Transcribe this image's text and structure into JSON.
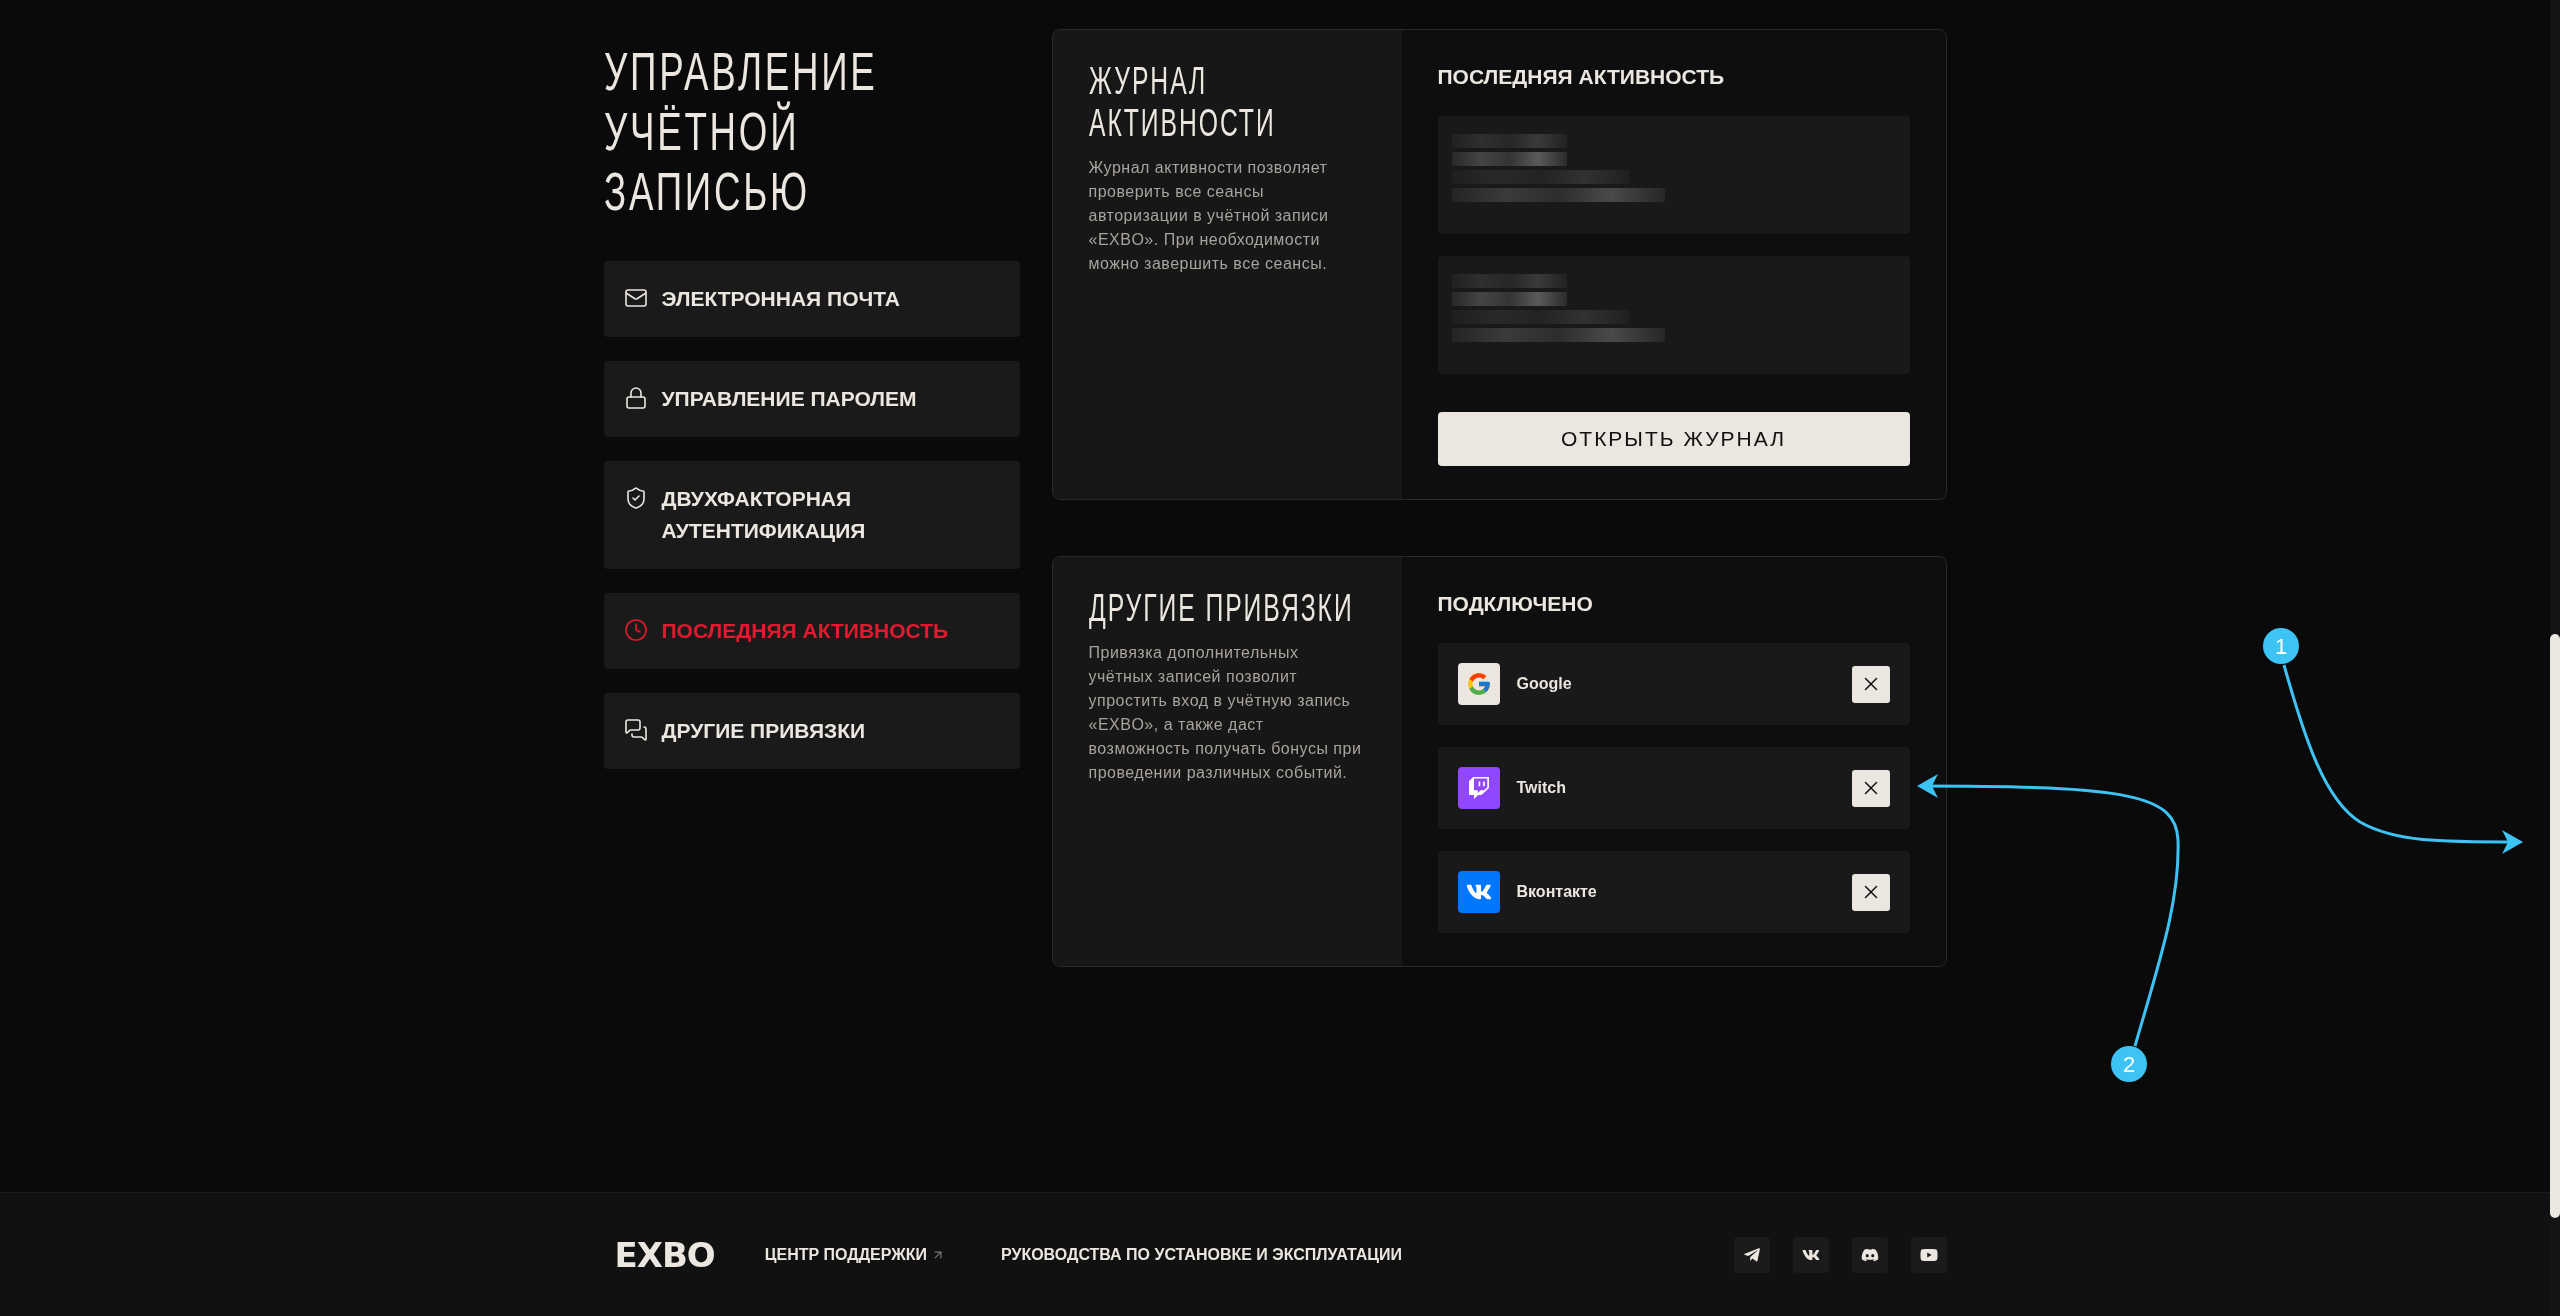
{
  "sidebar": {
    "title": "УПРАВЛЕНИЕ УЧЁТНОЙ ЗАПИСЬЮ",
    "items": [
      {
        "label": "ЭЛЕКТРОННАЯ ПОЧТА",
        "selected": false
      },
      {
        "label": "УПРАВЛЕНИЕ ПАРОЛЕМ",
        "selected": false
      },
      {
        "label": "ДВУХФАКТОРНАЯ АУТЕНТИФИКАЦИЯ",
        "selected": false
      },
      {
        "label": "ПОСЛЕДНЯЯ АКТИВНОСТЬ",
        "selected": true
      },
      {
        "label": "ДРУГИЕ ПРИВЯЗКИ",
        "selected": false
      }
    ]
  },
  "activity_card": {
    "title": "ЖУРНАЛ АКТИВНОСТИ",
    "description": "Журнал активности позволяет проверить все сеансы авторизации в учётной записи «EXBO». При необходимости можно завершить все сеансы.",
    "panel_title": "ПОСЛЕДНЯЯ АКТИВНОСТЬ",
    "button": "ОТКРЫТЬ ЖУРНАЛ"
  },
  "links_card": {
    "title": "ДРУГИЕ ПРИВЯЗКИ",
    "description": "Привязка дополнительных учётных записей позволит упростить вход в учётную запись «EXBO», а также даст возможность получать бонусы при проведении различных событий.",
    "panel_title": "ПОДКЛЮЧЕНО",
    "services": [
      {
        "name": "Google",
        "color": "#ebe6df"
      },
      {
        "name": "Twitch",
        "color": "#9146ff"
      },
      {
        "name": "Вконтакте",
        "color": "#0077ff"
      }
    ]
  },
  "footer": {
    "logo": "EXBO",
    "links": [
      {
        "label": "ЦЕНТР ПОДДЕРЖКИ",
        "external": true
      },
      {
        "label": "РУКОВОДСТВА ПО УСТАНОВКЕ И ЭКСПЛУАТАЦИИ",
        "external": false
      }
    ]
  },
  "annotations": [
    {
      "label": "1"
    },
    {
      "label": "2"
    }
  ]
}
